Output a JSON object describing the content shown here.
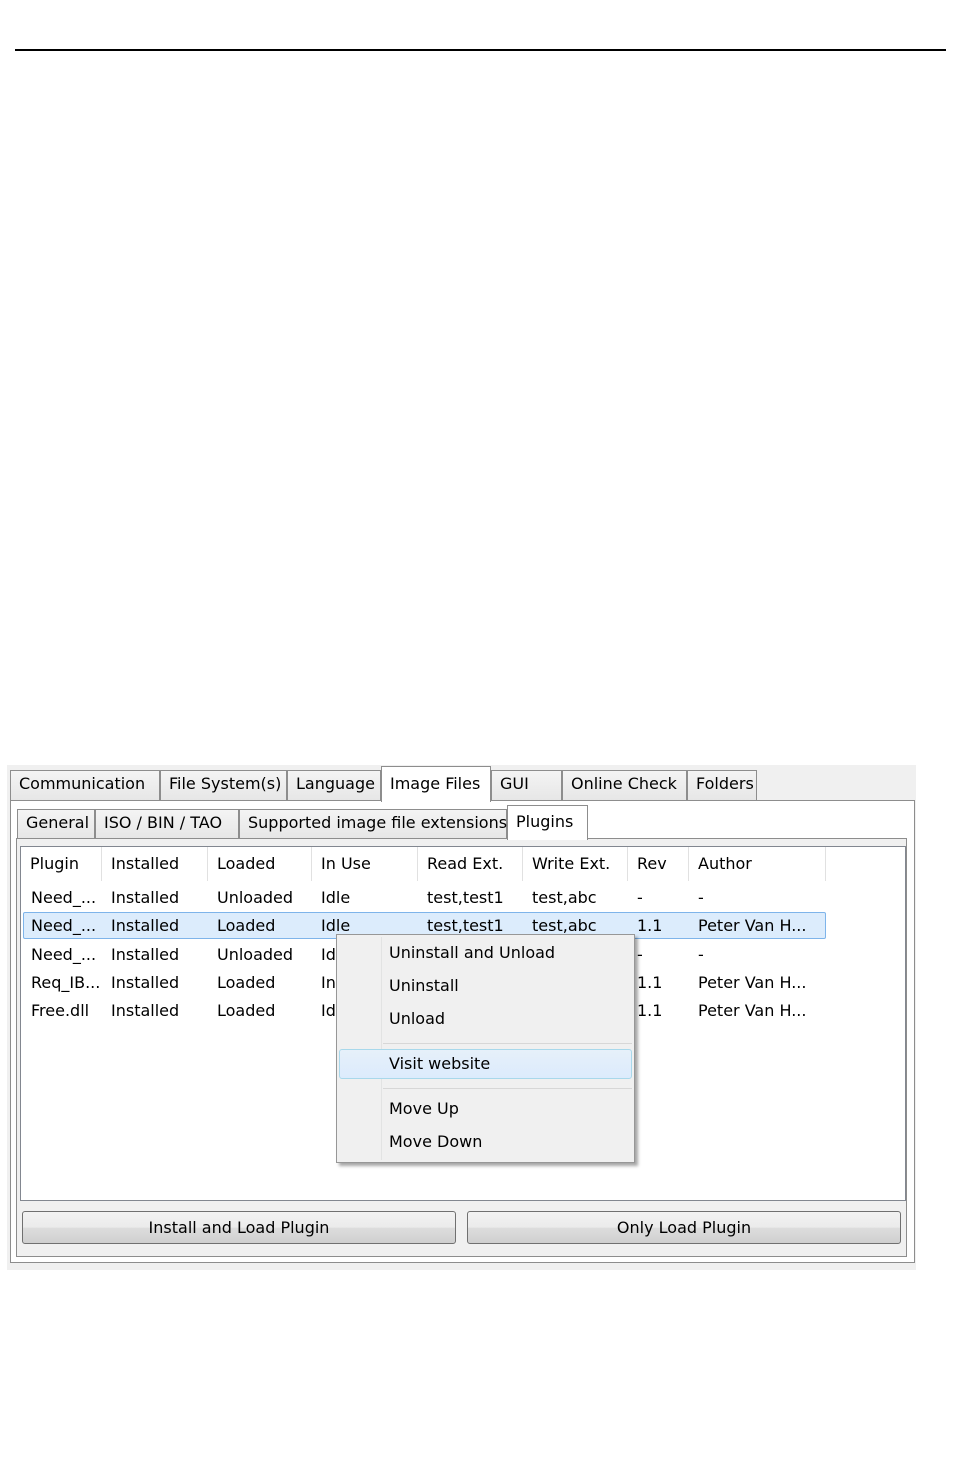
{
  "main_tabs": [
    {
      "label": "Communication"
    },
    {
      "label": "File System(s)"
    },
    {
      "label": "Language"
    },
    {
      "label": "Image Files"
    },
    {
      "label": "GUI"
    },
    {
      "label": "Online Check"
    },
    {
      "label": "Folders"
    }
  ],
  "sub_tabs": [
    {
      "label": "General"
    },
    {
      "label": "ISO / BIN / TAO"
    },
    {
      "label": "Supported image file extensions"
    },
    {
      "label": "Plugins"
    }
  ],
  "plugin_table": {
    "columns": [
      "Plugin",
      "Installed",
      "Loaded",
      "In Use",
      "Read Ext.",
      "Write Ext.",
      "Rev",
      "Author"
    ],
    "rows": [
      [
        "Need_...",
        "Installed",
        "Unloaded",
        "Idle",
        "test,test1",
        "test,abc",
        "-",
        "-"
      ],
      [
        "Need_...",
        "Installed",
        "Loaded",
        "Idle",
        "test,test1",
        "test,abc",
        "1.1",
        "Peter Van H..."
      ],
      [
        "Need_...",
        "Installed",
        "Unloaded",
        "Id",
        "",
        "",
        "-",
        "-"
      ],
      [
        "Req_IB...",
        "Installed",
        "Loaded",
        "In",
        "",
        "",
        "1.1",
        "Peter Van H..."
      ],
      [
        "Free.dll",
        "Installed",
        "Loaded",
        "Id",
        "",
        "",
        "1.1",
        "Peter Van H..."
      ]
    ]
  },
  "context_menu": {
    "uninstall_unload": "Uninstall and Unload",
    "uninstall": "Uninstall",
    "unload": "Unload",
    "visit_website": "Visit website",
    "move_up": "Move Up",
    "move_down": "Move Down"
  },
  "buttons": {
    "install_load": "Install and Load Plugin",
    "only_load": "Only Load Plugin"
  }
}
